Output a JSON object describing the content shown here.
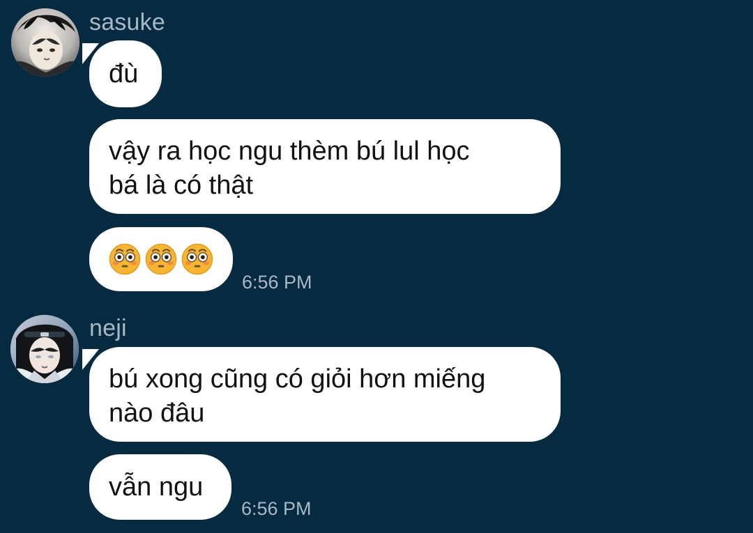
{
  "messages": [
    {
      "sender": "sasuke",
      "avatar_icon": "avatar-sasuke-icon",
      "bubbles": [
        {
          "text": "đù"
        },
        {
          "text": "vậy ra học ngu thèm bú lul học\nbá là có thật"
        },
        {
          "emoji": [
            "flushed-face-icon",
            "flushed-face-icon",
            "flushed-face-icon"
          ]
        }
      ],
      "time": "6:56 PM"
    },
    {
      "sender": "neji",
      "avatar_icon": "avatar-neji-icon",
      "bubbles": [
        {
          "text": "bú xong cũng có giỏi hơn miếng\nnào đâu"
        },
        {
          "text": "vẫn ngu"
        }
      ],
      "time": "6:56 PM"
    }
  ],
  "colors": {
    "background": "#062a40",
    "bubble": "#ffffff",
    "meta_text": "#a9b8c6",
    "message_text": "#111111"
  }
}
